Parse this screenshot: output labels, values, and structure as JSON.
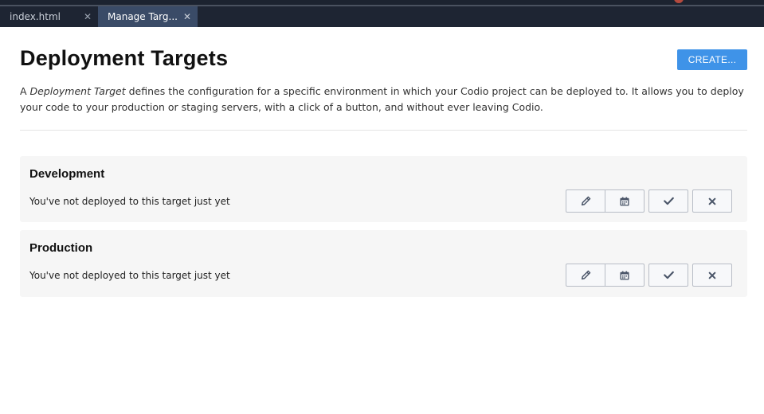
{
  "tabs": [
    {
      "label": "index.html",
      "active": false
    },
    {
      "label": "Manage Targ...",
      "active": true
    }
  ],
  "page": {
    "title": "Deployment Targets",
    "create_label": "CREATE...",
    "description_prefix": "A ",
    "description_term": "Deployment Target",
    "description_rest": " defines the configuration for a specific environment in which your Codio project can be deployed to. It allows you to deploy your code to your production or staging servers, with a click of a button, and without ever leaving Codio."
  },
  "targets": [
    {
      "name": "Development",
      "status": "You've not deployed to this target just yet"
    },
    {
      "name": "Production",
      "status": "You've not deployed to this target just yet"
    }
  ],
  "icons": {
    "edit": "pencil-icon",
    "schedule": "calendar-icon",
    "deploy": "check-icon",
    "delete": "close-icon"
  },
  "colors": {
    "accent": "#3f93e8",
    "tabbar": "#1e2533",
    "active_tab": "#3a4b67"
  }
}
